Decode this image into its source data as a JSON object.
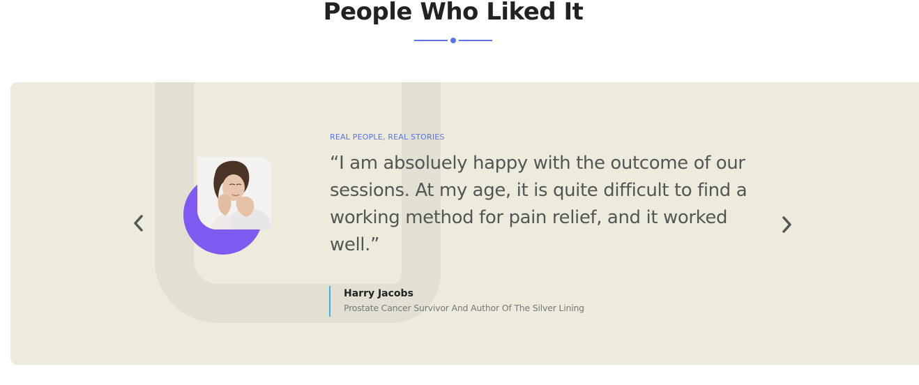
{
  "section": {
    "title": "People Who Liked It"
  },
  "testimonial": {
    "eyebrow": "REAL PEOPLE, REAL STORIES",
    "quote": "“I am absoluely happy with the outcome of our sessions. At my age, it is quite difficult to find a working method for pain relief, and it worked well.”",
    "author_name": "Harry Jacobs",
    "author_role": "Prostate Cancer Survivor And Author Of The Silver Lining"
  },
  "colors": {
    "accent": "#5b73e8",
    "card_background": "#edebdb",
    "avatar_ring": "#7f5af0",
    "author_bar": "#3fb1e8"
  },
  "icons": {
    "prev": "chevron-left-icon",
    "next": "chevron-right-icon"
  }
}
